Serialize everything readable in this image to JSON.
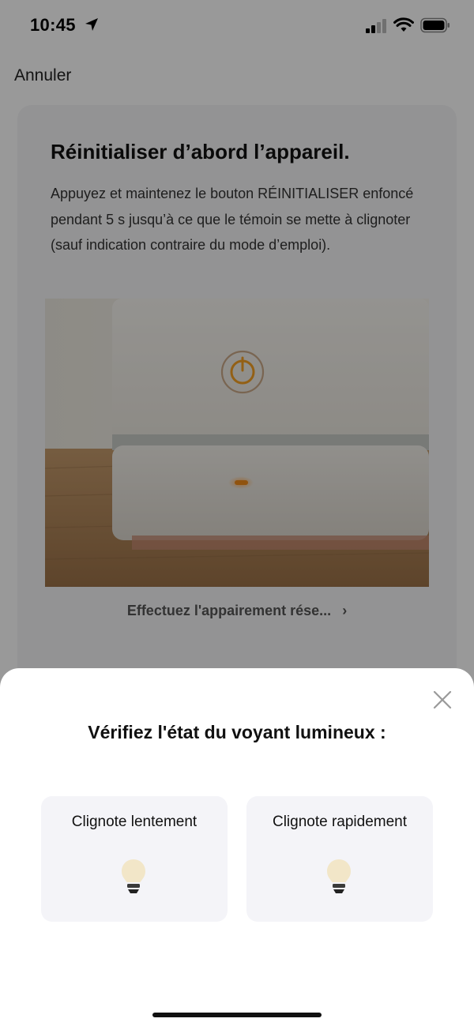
{
  "status_bar": {
    "time": "10:45",
    "icons": [
      "location-arrow-icon",
      "cellular-signal-icon",
      "wifi-icon",
      "battery-icon"
    ]
  },
  "nav": {
    "cancel_label": "Annuler"
  },
  "reset_card": {
    "title": "Réinitialiser d’abord l’appareil.",
    "description": "Appuyez et maintenez le bouton RÉINITIALISER enfoncé pendant 5 s jusqu’à ce que le témoin se mette à clignoter (sauf indication contraire du mode d’emploi).",
    "pairing_link": "Effectuez l'appairement rése...",
    "pairing_chevron": "›"
  },
  "sheet": {
    "title": "Vérifiez l'état du voyant lumineux :",
    "options": [
      {
        "label": "Clignote lentement",
        "icon": "light-bulb-icon"
      },
      {
        "label": "Clignote rapidement",
        "icon": "light-bulb-icon"
      }
    ]
  },
  "colors": {
    "overlay": "#000000",
    "card_bg": "#f6f6f7",
    "option_bg": "#f4f4f8",
    "indicator_orange": "#f5a023"
  }
}
